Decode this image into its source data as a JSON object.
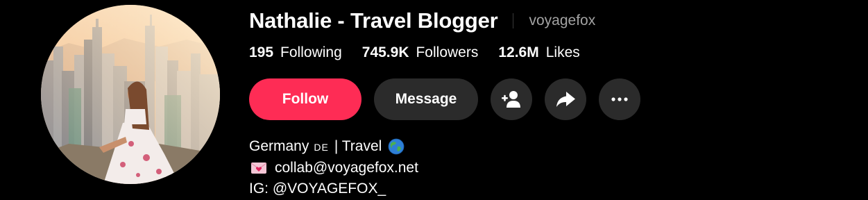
{
  "profile": {
    "display_name": "Nathalie - Travel Blogger",
    "username": "voyagefox"
  },
  "stats": {
    "following": {
      "value": "195",
      "label": "Following"
    },
    "followers": {
      "value": "745.9K",
      "label": "Followers"
    },
    "likes": {
      "value": "12.6M",
      "label": "Likes"
    }
  },
  "actions": {
    "follow_label": "Follow",
    "message_label": "Message",
    "add_friend_icon": "person-plus-icon",
    "share_icon": "share-arrow-icon",
    "more_icon": "more-dots-icon"
  },
  "bio": {
    "line1_prefix": "Germany",
    "line1_flag": "DE",
    "line1_suffix": "| Travel",
    "line1_emoji": "globe-icon",
    "line2_emoji": "envelope-heart-icon",
    "line2_text": "collab@voyagefox.net",
    "line3_text": "IG: @VOYAGEFOX_"
  },
  "colors": {
    "background": "#000000",
    "follow_button": "#fe2c55",
    "secondary_button": "#2b2b2b",
    "muted_text": "#a3a3a3"
  }
}
